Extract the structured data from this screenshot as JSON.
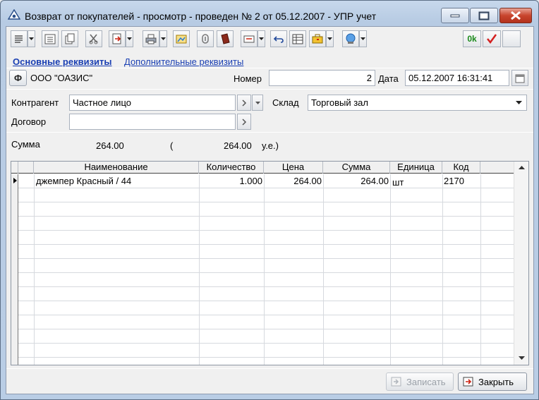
{
  "window": {
    "title": "Возврат от покупателей - просмотр - проведен № 2 от 05.12.2007 - УПР учет"
  },
  "tabs": {
    "main": "Основные реквизиты",
    "extra": "Дополнительные реквизиты"
  },
  "org": {
    "button_label": "Ф",
    "name": "ООО \"ОАЗИС\""
  },
  "number": {
    "label": "Номер",
    "value": "2"
  },
  "date": {
    "label": "Дата",
    "value": "05.12.2007 16:31:41"
  },
  "counterparty": {
    "label": "Контрагент",
    "value": "Частное лицо"
  },
  "warehouse": {
    "label": "Склад",
    "value": "Торговый зал"
  },
  "contract": {
    "label": "Договор",
    "value": ""
  },
  "sum": {
    "label": "Сумма",
    "value": "264.00",
    "open_paren": "(",
    "ue_value": "264.00",
    "ue_unit": "у.е.)"
  },
  "grid": {
    "columns": [
      "Наименование",
      "Количество",
      "Цена",
      "Сумма",
      "Единица",
      "Код"
    ],
    "rows": [
      {
        "name": "джемпер Красный / 44",
        "qty": "1.000",
        "price": "264.00",
        "sum": "264.00",
        "unit": "шт",
        "code": "2170"
      }
    ]
  },
  "footer": {
    "save": "Записать",
    "close": "Закрыть"
  },
  "toolbar": {
    "ok_label": "0k"
  },
  "colors": {
    "link": "#1a3fb3",
    "close_button": "#c8452e",
    "ok_green": "#1a8a1a",
    "check_red": "#d42020"
  }
}
